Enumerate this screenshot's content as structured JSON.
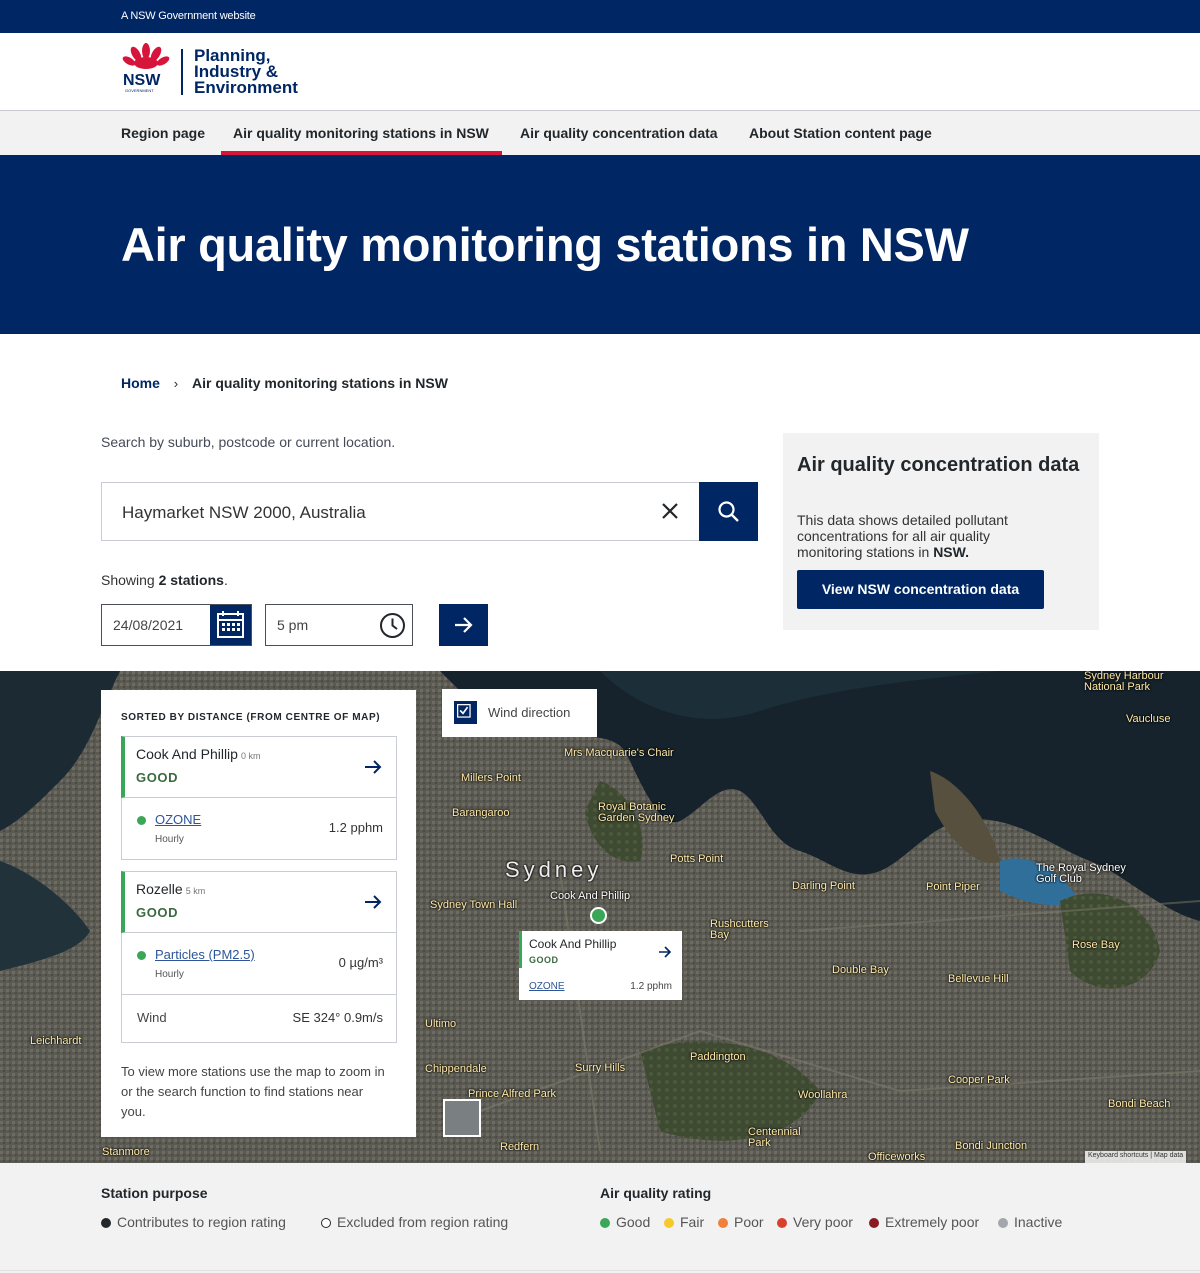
{
  "masthead": {
    "text": "A NSW Government website"
  },
  "brand": {
    "logo_word": "NSW",
    "logo_sub": "GOVERNMENT",
    "line1": "Planning,",
    "line2": "Industry &",
    "line3": "Environment"
  },
  "nav": {
    "items": [
      {
        "label": "Region page",
        "active": false
      },
      {
        "label": "Air quality monitoring stations in NSW",
        "active": true
      },
      {
        "label": "Air quality concentration data",
        "active": false
      },
      {
        "label": "About Station content page",
        "active": false
      }
    ],
    "active_color": "#d7153a"
  },
  "hero": {
    "title": "Air quality monitoring stations in NSW",
    "bg": "#002664"
  },
  "breadcrumb": {
    "home": "Home",
    "current": "Air quality monitoring stations in NSW"
  },
  "search": {
    "hint": "Search by suburb, postcode or current location.",
    "value": "Haymarket NSW 2000, Australia",
    "showing_prefix": "Showing ",
    "showing_count": "2 stations",
    "showing_suffix": ".",
    "date": "24/08/2021",
    "time": "5 pm"
  },
  "side_card": {
    "title": "Air quality concentration data",
    "body": "This data shows detailed pollutant concentrations for all air quality monitoring stations in ",
    "body_bold": "NSW.",
    "button": "View NSW concentration data"
  },
  "station_panel": {
    "sort_label": "SORTED BY DISTANCE (FROM CENTRE OF MAP)",
    "stations": [
      {
        "name": "Cook And Phillip",
        "distance": "0 km",
        "rating": "GOOD",
        "pollutant": "OZONE",
        "period": "Hourly",
        "value": "1.2 pphm"
      },
      {
        "name": "Rozelle",
        "distance": "5 km",
        "rating": "GOOD",
        "pollutant": "Particles (PM2.5)",
        "period": "Hourly",
        "value": "0 µg/m³",
        "wind_label": "Wind",
        "wind_value": "SE 324° 0.9m/s"
      }
    ],
    "note": "To view more stations use the map to zoom in or the search function to find stations near you."
  },
  "map": {
    "wind_toggle": "Wind direction",
    "wind_checked": true,
    "popup": {
      "name": "Cook And Phillip",
      "rating": "GOOD",
      "pollutant": "OZONE",
      "value": "1.2 pphm"
    },
    "labels": {
      "sydney": "Sydney",
      "cook": "Cook And Phillip",
      "macquarie": "Mrs Macquarie's Chair",
      "milsons": "Millers Point",
      "barangaroo": "Barangaroo",
      "botanic": "Royal Botanic Garden Sydney",
      "potts": "Potts Point",
      "darling_pt": "Darling Point",
      "point_piper": "Point Piper",
      "golf": "The Royal Sydney Golf Club",
      "rose_bay": "Rose Bay",
      "bellevue": "Bellevue Hill",
      "double_bay": "Double Bay",
      "rushcutters": "Rushcutters Bay",
      "paddington": "Paddington",
      "surry": "Surry Hills",
      "ultimo": "Ultimo",
      "chippendale": "Chippendale",
      "redfern": "Redfern",
      "woollahra": "Woollahra",
      "centennial": "Centennial Park",
      "bondi_jn": "Bondi Junction",
      "bondi_beach": "Bondi Beach",
      "vaucluse": "Vaucluse",
      "harbour_np": "Sydney Harbour National Park",
      "leichhardt": "Leichhardt",
      "stanmore": "Stanmore",
      "cooper": "Cooper Park",
      "prince_alfred": "Prince Alfred Park",
      "town_hall": "Sydney Town Hall",
      "officeworks": "Officeworks"
    },
    "attribution": "Keyboard shortcuts | Map data"
  },
  "legend": {
    "purpose_title": "Station purpose",
    "purpose_items": [
      "Contributes to region rating",
      "Excluded from region rating"
    ],
    "rating_title": "Air quality rating",
    "rating_items": [
      {
        "label": "Good",
        "color": "#3aa657"
      },
      {
        "label": "Fair",
        "color": "#f5c92c"
      },
      {
        "label": "Poor",
        "color": "#f0813a"
      },
      {
        "label": "Very poor",
        "color": "#d9412d"
      },
      {
        "label": "Extremely poor",
        "color": "#8a1a22"
      },
      {
        "label": "Inactive",
        "color": "#a3a6ab"
      }
    ]
  }
}
